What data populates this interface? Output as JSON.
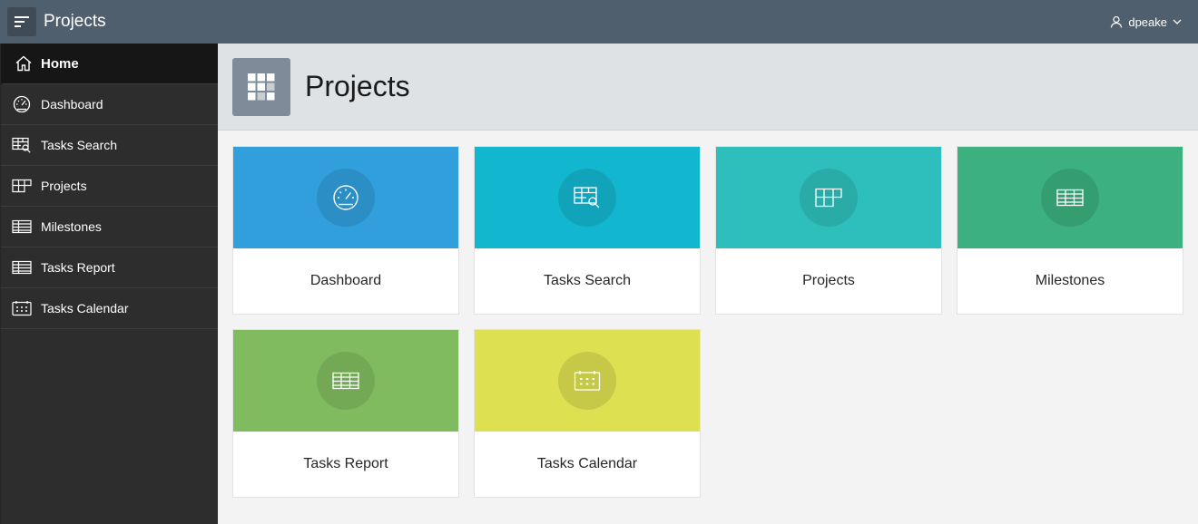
{
  "header": {
    "app_title": "Projects",
    "menu_icon": "hamburger-menu-icon",
    "user_name": "dpeake",
    "background": "#505f6d"
  },
  "sidebar": {
    "items": [
      {
        "label": "Home",
        "icon": "home-icon",
        "active": true
      },
      {
        "label": "Dashboard",
        "icon": "gauge-icon"
      },
      {
        "label": "Tasks Search",
        "icon": "table-search-icon"
      },
      {
        "label": "Projects",
        "icon": "table-grid-icon"
      },
      {
        "label": "Milestones",
        "icon": "table-icon"
      },
      {
        "label": "Tasks Report",
        "icon": "table-icon"
      },
      {
        "label": "Tasks Calendar",
        "icon": "calendar-icon"
      }
    ]
  },
  "hero": {
    "title": "Projects",
    "icon": "app-grid-icon",
    "icon_color": "#7f8b98"
  },
  "cards": [
    {
      "label": "Dashboard",
      "icon": "gauge-icon",
      "color": "#309fdb"
    },
    {
      "label": "Tasks Search",
      "icon": "table-search-icon",
      "color": "#13b6cf"
    },
    {
      "label": "Projects",
      "icon": "table-grid-icon",
      "color": "#2ebfbc"
    },
    {
      "label": "Milestones",
      "icon": "table-icon",
      "color": "#3cb07e"
    },
    {
      "label": "Tasks Report",
      "icon": "table-icon",
      "color": "#81bb5f"
    },
    {
      "label": "Tasks Calendar",
      "icon": "calendar-icon",
      "color": "#dde051"
    }
  ]
}
